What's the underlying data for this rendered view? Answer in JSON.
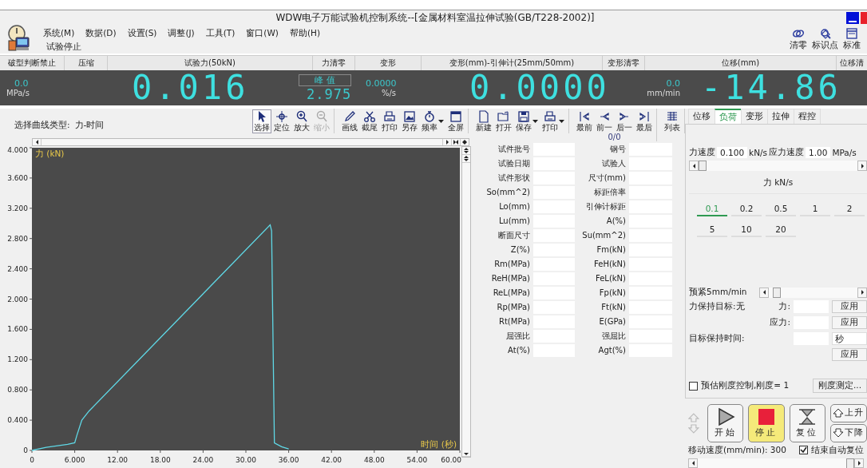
{
  "window": {
    "title": "WDW电子万能试验机控制系统--[金属材料室温拉伸试验(GB/T228-2002)]"
  },
  "menu": [
    "系统(M)",
    "数据(D)",
    "设置(S)",
    "调整(J)",
    "工具(T)",
    "窗口(W)",
    "帮助(H)"
  ],
  "status_text": "试验停止",
  "quick_tools": [
    {
      "label": "清零"
    },
    {
      "label": "标识点"
    },
    {
      "label": "标准"
    }
  ],
  "channel_header": [
    "破型判断禁止",
    "压缩",
    "试验力(50kN)",
    "力清零",
    "变形",
    "变形(mm)-引伸计(25mm/50mm)",
    "变形清零",
    "位移(mm)",
    "位移清"
  ],
  "display": {
    "stress_rate": {
      "value": "0.0",
      "unit": "MPa/s"
    },
    "force": "0.016",
    "peak": {
      "label": "峰 值",
      "value": "2.975"
    },
    "strain_rate": {
      "value": "0.0000",
      "unit": "%/s"
    },
    "deformation": "0.0000",
    "speed": {
      "value": "0.0",
      "unit": "mm/min"
    },
    "displacement": "-14.86"
  },
  "toolbar": {
    "curve_type_label": "选择曲线类型:",
    "curve_type": "力-时间",
    "counter": "0/0",
    "groups": [
      {
        "items": [
          {
            "label": "选择",
            "selected": true,
            "disabled": false,
            "dropdown": false
          },
          {
            "label": "定位",
            "selected": false,
            "disabled": false,
            "dropdown": false
          },
          {
            "label": "放大",
            "selected": false,
            "disabled": false,
            "dropdown": false
          },
          {
            "label": "缩小",
            "selected": false,
            "disabled": true,
            "dropdown": false
          }
        ]
      },
      {
        "items": [
          {
            "label": "画线",
            "selected": false,
            "disabled": false,
            "dropdown": false
          },
          {
            "label": "截尾",
            "selected": false,
            "disabled": false,
            "dropdown": false
          },
          {
            "label": "打印",
            "selected": false,
            "disabled": false,
            "dropdown": false
          },
          {
            "label": "另存",
            "selected": false,
            "disabled": false,
            "dropdown": false
          },
          {
            "label": "频率",
            "selected": false,
            "disabled": false,
            "dropdown": true
          },
          {
            "label": "全屏",
            "selected": false,
            "disabled": false,
            "dropdown": false
          }
        ]
      },
      {
        "items": [
          {
            "label": "新建",
            "selected": false,
            "disabled": false,
            "dropdown": false
          },
          {
            "label": "打开",
            "selected": false,
            "disabled": false,
            "dropdown": false
          },
          {
            "label": "保存",
            "selected": false,
            "disabled": false,
            "dropdown": true
          },
          {
            "label": "打印",
            "selected": false,
            "disabled": false,
            "dropdown": true
          }
        ]
      },
      {
        "items": [
          {
            "label": "最前",
            "selected": false,
            "disabled": false,
            "dropdown": false
          },
          {
            "label": "前一",
            "selected": false,
            "disabled": false,
            "dropdown": false
          },
          {
            "label": "后一",
            "selected": false,
            "disabled": false,
            "dropdown": false
          },
          {
            "label": "最后",
            "selected": false,
            "disabled": false,
            "dropdown": false
          }
        ]
      },
      {
        "items": [
          {
            "label": "列表",
            "selected": false,
            "disabled": false,
            "dropdown": false
          }
        ]
      }
    ]
  },
  "chart_data": {
    "type": "line",
    "xlabel": "时间 (秒)",
    "ylabel": "力 (kN)",
    "x": [
      0,
      2,
      5,
      6,
      6.3,
      7,
      8,
      33.4,
      33.6,
      34,
      35,
      36
    ],
    "series": [
      {
        "color": "#5fd8e6",
        "values": [
          0,
          0.04,
          0.08,
          0.1,
          0.2,
          0.4,
          0.52,
          2.98,
          2.9,
          0.1,
          0.05,
          0.02
        ]
      }
    ],
    "xlim": [
      0,
      60
    ],
    "ylim": [
      0,
      4
    ],
    "xticks": [
      {
        "value": 0,
        "label": "0"
      },
      {
        "value": 6,
        "label": "6.000"
      },
      {
        "value": 12,
        "label": "12.00"
      },
      {
        "value": 18,
        "label": "18.00"
      },
      {
        "value": 24,
        "label": "24.00"
      },
      {
        "value": 30,
        "label": "30.00"
      },
      {
        "value": 36,
        "label": "36.00"
      },
      {
        "value": 42,
        "label": "42.00"
      },
      {
        "value": 48,
        "label": "48.00"
      },
      {
        "value": 54,
        "label": "54.00"
      },
      {
        "value": 60,
        "label": "60.00"
      }
    ],
    "yticks": [
      {
        "value": 0,
        "label": "0"
      },
      {
        "value": 0.4,
        "label": "0.400"
      },
      {
        "value": 0.8,
        "label": "0.800"
      },
      {
        "value": 1.2,
        "label": "1.200"
      },
      {
        "value": 1.6,
        "label": "1.600"
      },
      {
        "value": 2,
        "label": "2.000"
      },
      {
        "value": 2.4,
        "label": "2.400"
      },
      {
        "value": 2.8,
        "label": "2.800"
      },
      {
        "value": 3.2,
        "label": "3.200"
      },
      {
        "value": 3.6,
        "label": "3.600"
      },
      {
        "value": 4,
        "label": "4.000"
      }
    ]
  },
  "results": [
    [
      "试件批号",
      "钢号"
    ],
    [
      "试验日期",
      "试验人"
    ],
    [
      "试件形状",
      "尺寸(mm)"
    ],
    [
      "So(mm^2)",
      "标距倍率"
    ],
    [
      "Lo(mm)",
      "引伸计标距"
    ],
    [
      "Lu(mm)",
      "A(%)"
    ],
    [
      "断面尺寸",
      "Su(mm^2)"
    ],
    [
      "Z(%)",
      "Fm(kN)"
    ],
    [
      "Rm(MPa)",
      "FeH(kN)"
    ],
    [
      "ReH(MPa)",
      "FeL(kN)"
    ],
    [
      "ReL(MPa)",
      "Fp(kN)"
    ],
    [
      "Rp(MPa)",
      "Ft(kN)"
    ],
    [
      "Rt(MPa)",
      "E(GPa)"
    ],
    [
      "屈强比",
      "强屈比"
    ],
    [
      "At(%)",
      "Agt(%)"
    ]
  ],
  "control": {
    "tabs": [
      {
        "label": "位移",
        "selected": false
      },
      {
        "label": "负荷",
        "selected": true
      },
      {
        "label": "变形",
        "selected": false
      },
      {
        "label": "拉伸",
        "selected": false
      },
      {
        "label": "程控",
        "selected": false
      }
    ],
    "force_rate": {
      "label": "力速度",
      "value": "0.100",
      "unit": "kN/s"
    },
    "stress_rate": {
      "label": "应力速度",
      "value": "1.00",
      "unit": "MPa/s"
    },
    "rate_slider": {
      "level": 0
    },
    "preset_title": "力 kN/s",
    "presets": [
      {
        "label": "0.1",
        "selected": true
      },
      {
        "label": "0.2",
        "selected": false
      },
      {
        "label": "0.5",
        "selected": false
      },
      {
        "label": "1",
        "selected": false
      },
      {
        "label": "2",
        "selected": false
      },
      {
        "label": "5",
        "selected": false
      },
      {
        "label": "10",
        "selected": false
      },
      {
        "label": "20",
        "selected": false
      }
    ],
    "preload": {
      "label": "预紧5mm/min",
      "level": 0.05
    },
    "hold_target": "力保持目标:无",
    "hold_force": {
      "label": "力:",
      "button": "应用"
    },
    "hold_stress": {
      "label": "应力:",
      "button": "应用"
    },
    "hold_time": {
      "label": "目标保持时间:",
      "unit": "秒",
      "button": "应用"
    },
    "stiffness": {
      "label": "预估刚度控制,刚度= 1",
      "checked": false,
      "button": "刚度测定..."
    }
  },
  "motion": {
    "buttons": [
      {
        "label": "开始",
        "kind": "start",
        "active": false
      },
      {
        "label": "停止",
        "kind": "stop",
        "active": true
      },
      {
        "label": "复位",
        "kind": "reset",
        "active": false
      },
      {
        "label": "上升",
        "kind": "up",
        "active": false
      },
      {
        "label": "下降",
        "kind": "down",
        "active": false
      }
    ],
    "speed_text": "移动速度(mm/min): 300",
    "auto_reset": {
      "label": "结束自动复位",
      "checked": true
    },
    "speed_slider": {
      "level": 1
    }
  }
}
